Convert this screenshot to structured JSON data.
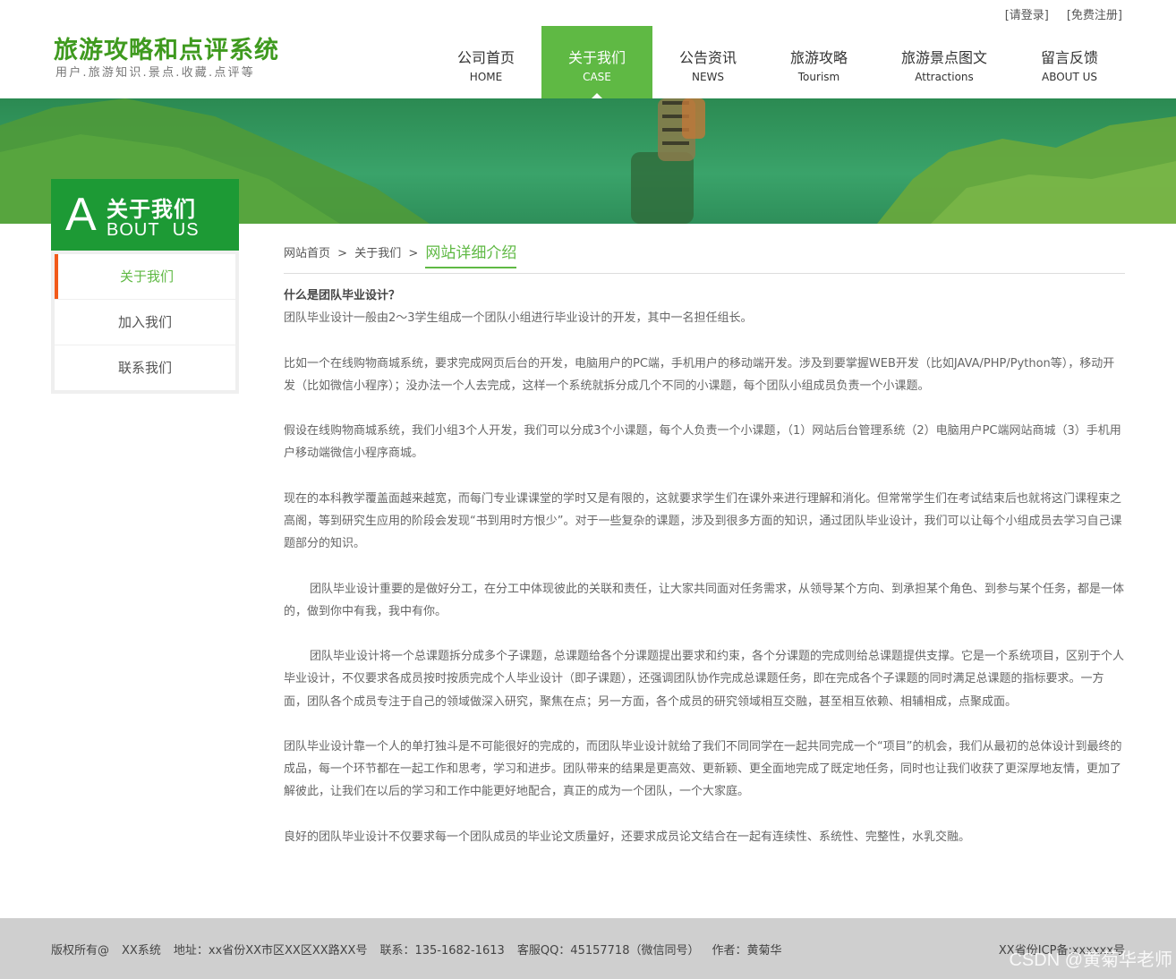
{
  "header": {
    "title": "旅游攻略和点评系统",
    "subtitle": "用户.旅游知识.景点.收藏.点评等",
    "login_link": "[请登录]",
    "register_link": "[免费注册]"
  },
  "nav": [
    {
      "zh": "公司首页",
      "en": "HOME"
    },
    {
      "zh": "关于我们",
      "en": "CASE"
    },
    {
      "zh": "公告资讯",
      "en": "NEWS"
    },
    {
      "zh": "旅游攻略",
      "en": "Tourism"
    },
    {
      "zh": "旅游景点图文",
      "en": "Attractions"
    },
    {
      "zh": "留言反馈",
      "en": "ABOUT US"
    }
  ],
  "side": {
    "big_letter": "A",
    "title_zh": "关于我们",
    "title_en": "BOUT US",
    "items": [
      "关于我们",
      "加入我们",
      "联系我们"
    ]
  },
  "breadcrumb": {
    "home": "网站首页",
    "sep1": ">",
    "section": "关于我们",
    "sep2": ">",
    "current": "网站详细介绍"
  },
  "content": {
    "question": "什么是团队毕业设计？",
    "p1": "团队毕业设计一般由2～3学生组成一个团队小组进行毕业设计的开发，其中一名担任组长。",
    "p2": "比如一个在线购物商城系统，要求完成网页后台的开发，电脑用户的PC端，手机用户的移动端开发。涉及到要掌握WEB开发（比如JAVA/PHP/Python等），移动开发（比如微信小程序）；没办法一个人去完成，这样一个系统就拆分成几个不同的小课题，每个团队小组成员负责一个小课题。",
    "p3": "假设在线购物商城系统，我们小组3个人开发，我们可以分成3个小课题，每个人负责一个小课题，（1）网站后台管理系统（2）电脑用户PC端网站商城（3）手机用户移动端微信小程序商城。",
    "p4": "现在的本科教学覆盖面越来越宽，而每门专业课课堂的学时又是有限的，这就要求学生们在课外来进行理解和消化。但常常学生们在考试结束后也就将这门课程束之高阁，等到研究生应用的阶段会发现“书到用时方恨少”。对于一些复杂的课题，涉及到很多方面的知识，通过团队毕业设计，我们可以让每个小组成员去学习自己课题部分的知识。",
    "p5": "团队毕业设计重要的是做好分工，在分工中体现彼此的关联和责任，让大家共同面对任务需求，从领导某个方向、到承担某个角色、到参与某个任务，都是一体的，做到你中有我，我中有你。",
    "p6": "团队毕业设计将一个总课题拆分成多个子课题，总课题给各个分课题提出要求和约束，各个分课题的完成则给总课题提供支撑。它是一个系统项目，区别于个人毕业设计，不仅要求各成员按时按质完成个人毕业设计（即子课题），还强调团队协作完成总课题任务，即在完成各个子课题的同时满足总课题的指标要求。一方面，团队各个成员专注于自己的领域做深入研究，聚焦在点；另一方面，各个成员的研究领域相互交融，甚至相互依赖、相辅相成，点聚成面。",
    "p7": "团队毕业设计靠一个人的单打独斗是不可能很好的完成的，而团队毕业设计就给了我们不同同学在一起共同完成一个“项目”的机会，我们从最初的总体设计到最终的成品，每一个环节都在一起工作和思考，学习和进步。团队带来的结果是更高效、更新颖、更全面地完成了既定地任务，同时也让我们收获了更深厚地友情，更加了解彼此，让我们在以后的学习和工作中能更好地配合，真正的成为一个团队，一个大家庭。",
    "p8": "良好的团队毕业设计不仅要求每一个团队成员的毕业论文质量好，还要求成员论文结合在一起有连续性、系统性、完整性，水乳交融。"
  },
  "footer": {
    "copyright": "版权所有@",
    "company": "XX系统",
    "address": "地址：xx省份XX市区XX区XX路XX号",
    "phone": "联系：135-1682-1613",
    "qq": "客服QQ：45157718（微信同号）",
    "author": "作者：黄菊华",
    "icp": "XX省份ICP备:xxxxxx号"
  },
  "watermark": "CSDN @黄菊华老师",
  "colors": {
    "brand_green": "#5fb944",
    "side_green": "#1d9a35",
    "active_marker": "#f25a1a",
    "footer_bg": "#cfcfcf"
  }
}
